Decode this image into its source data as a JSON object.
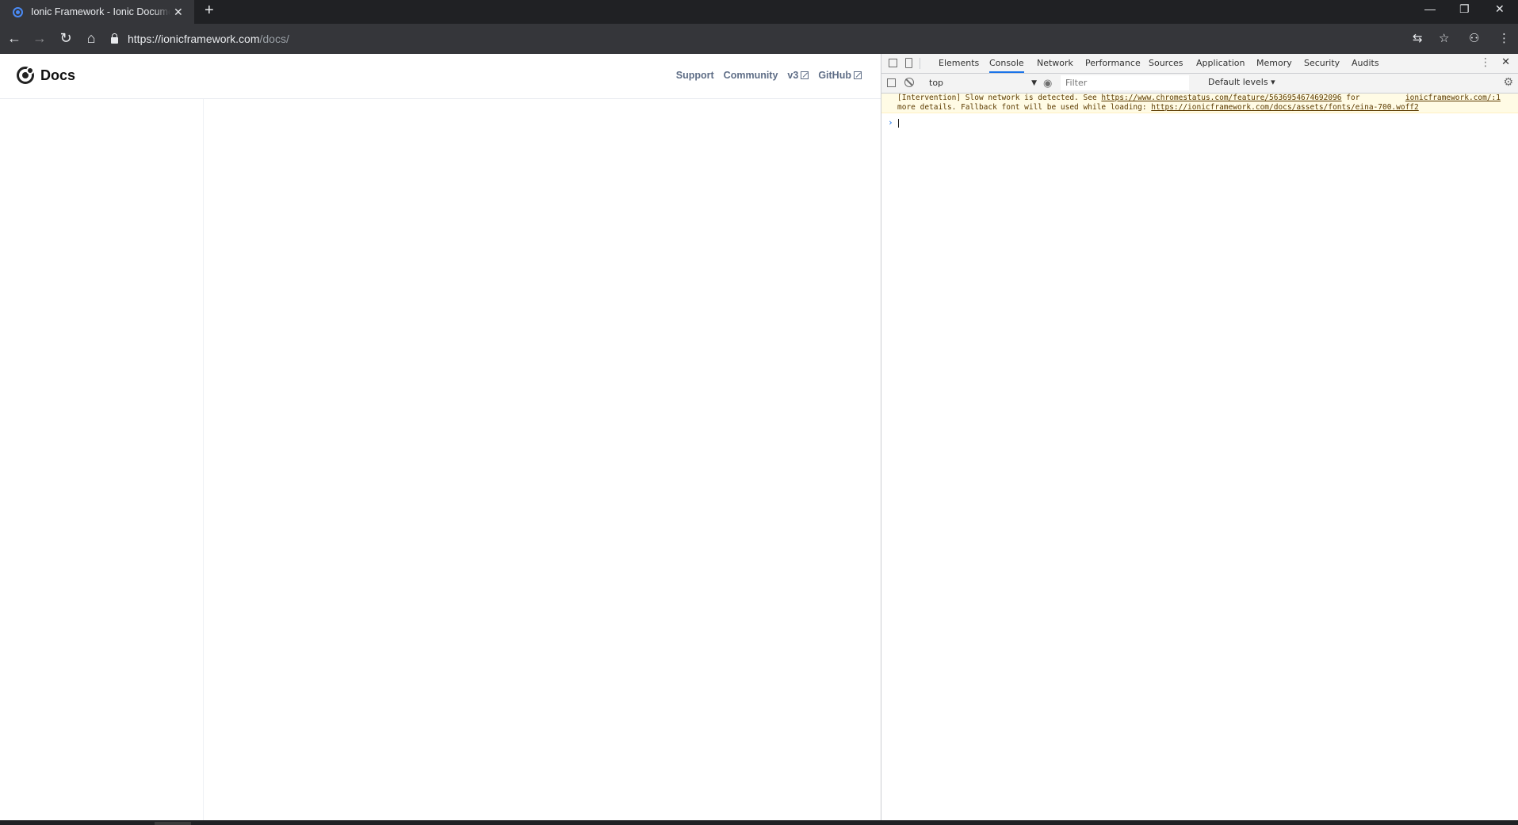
{
  "browser": {
    "tab_title": "Ionic Framework - Ionic Documentation",
    "tab_close": "✕",
    "new_tab": "+",
    "window_controls": {
      "minimize": "—",
      "restore": "❐",
      "close": "✕"
    },
    "url_host": "https://ionicframework.com",
    "url_path": "/docs/",
    "icons": [
      "back-icon",
      "forward-icon",
      "reload-icon",
      "home-icon",
      "lock-icon",
      "translate-icon",
      "bookmark-star-icon",
      "extension-icon",
      "menu-icon"
    ]
  },
  "page": {
    "logo_text": "Docs",
    "nav": [
      {
        "label": "Support"
      },
      {
        "label": "Community"
      },
      {
        "label": "v3"
      },
      {
        "label": "GitHub"
      }
    ]
  },
  "devtools": {
    "tabs": [
      "Elements",
      "Console",
      "Network",
      "Performance",
      "Sources",
      "Application",
      "Memory",
      "Security",
      "Audits"
    ],
    "active_tab": "Console",
    "context": "top",
    "filter_placeholder": "Filter",
    "levels": "Default levels ▾",
    "warning": {
      "line1_prefix": "[Intervention] Slow network is detected. See ",
      "line1_link": "https://www.chromestatus.com/feature/5636954674692096",
      "line1_suffix": " for",
      "line2_prefix": "more details. Fallback font will be used while loading: ",
      "line2_link": "https://ionicframework.com/docs/assets/fonts/eina-700.woff2",
      "source": "ionicframework.com/:1"
    },
    "prompt": "›",
    "accent_color": "#1a73e8"
  },
  "colors": {
    "title_bar": "#202124",
    "toolbar": "#35363a",
    "nav_link": "#5e6d86",
    "warning_bg": "#fffbe5"
  }
}
